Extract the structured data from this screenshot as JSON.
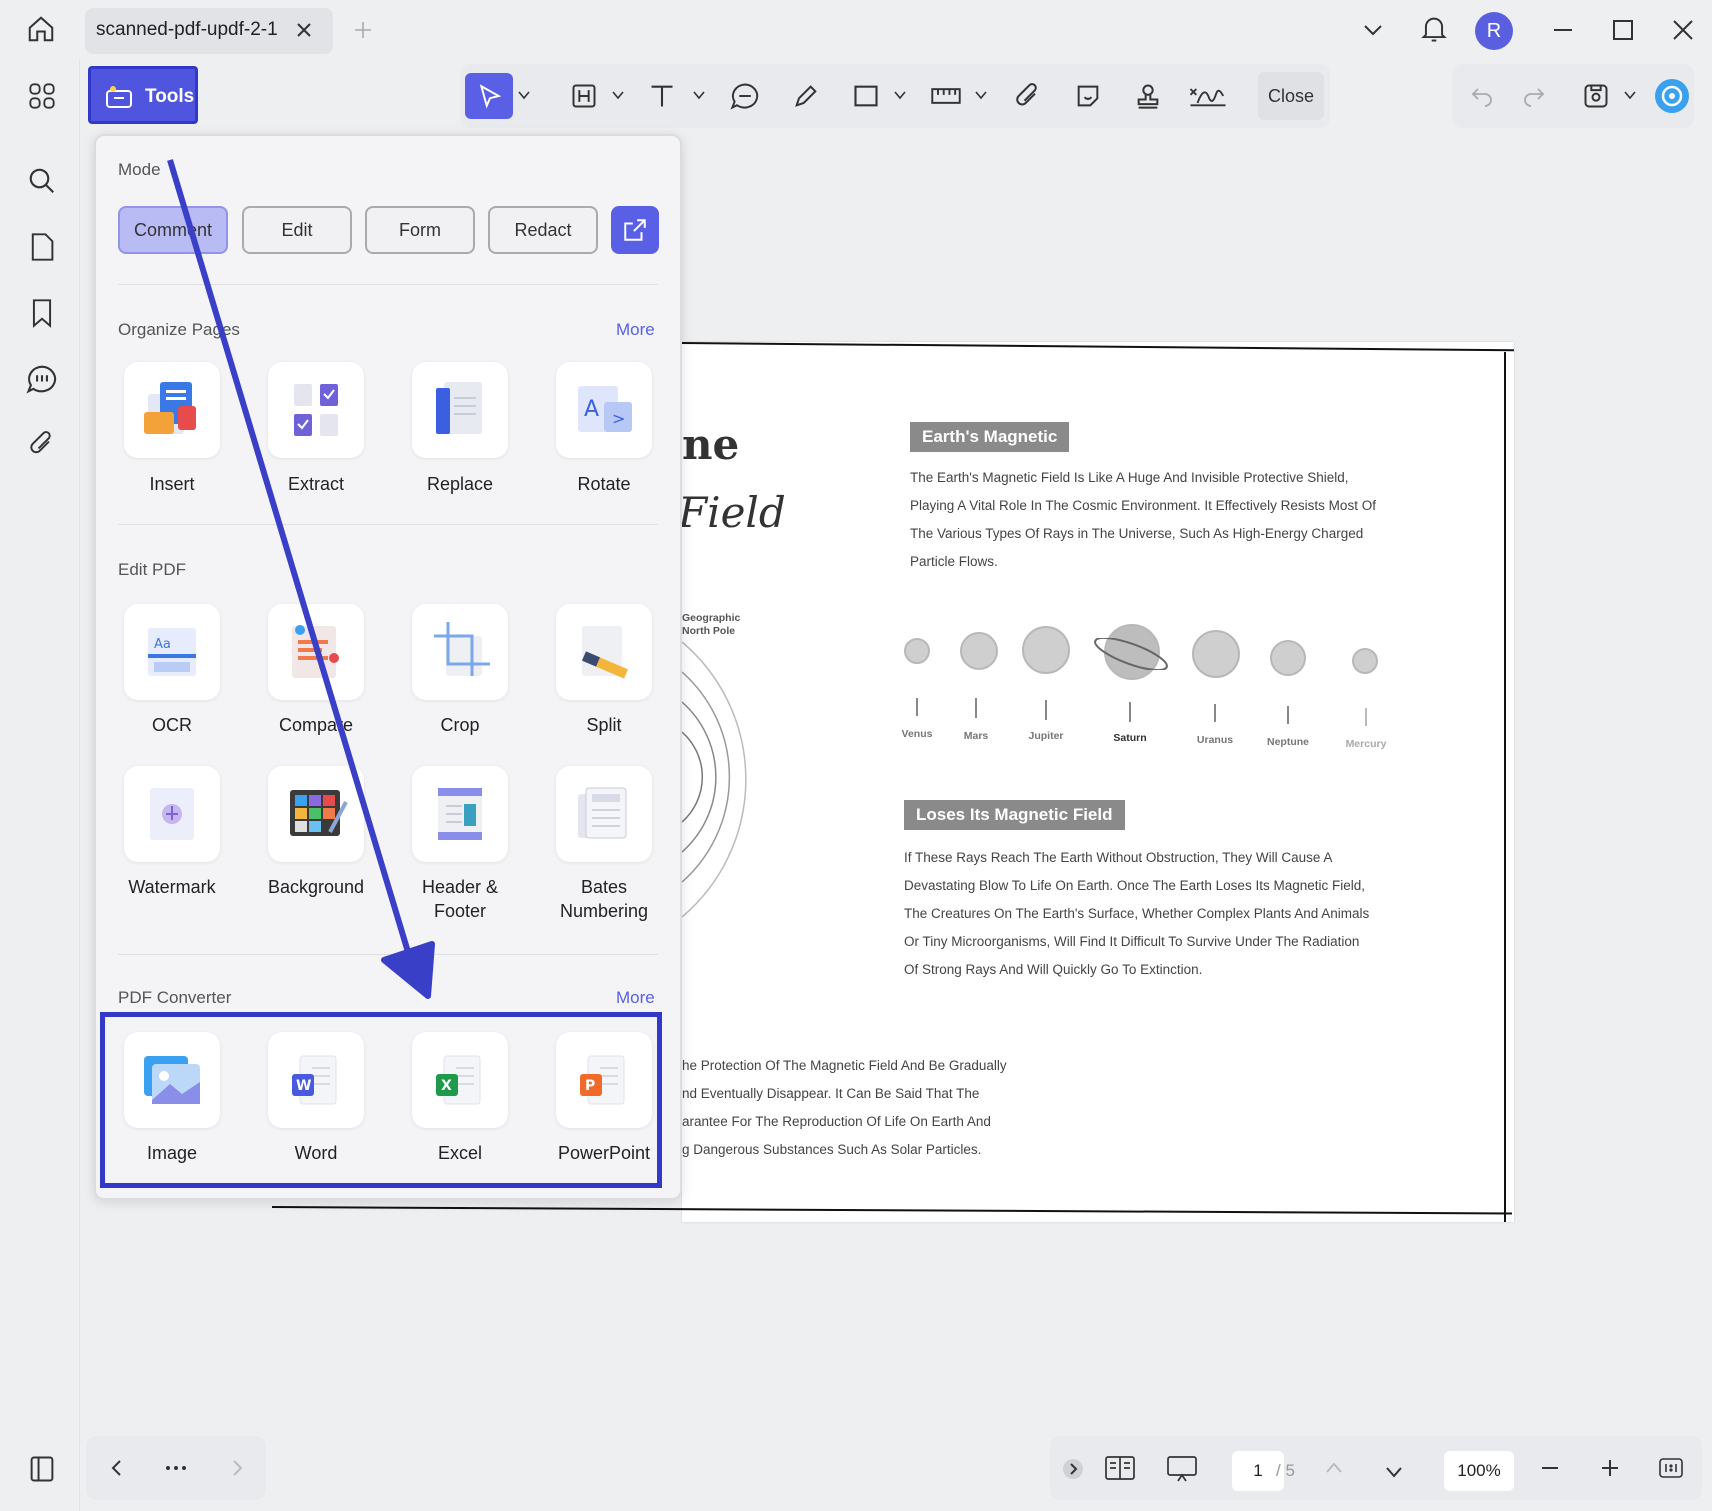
{
  "app": {
    "tab_title": "scanned-pdf-updf-2-1",
    "user_initial": "R"
  },
  "toolbar": {
    "tools_label": "Tools",
    "close_label": "Close"
  },
  "panel": {
    "mode_title": "Mode",
    "modes": [
      "Comment",
      "Edit",
      "Form",
      "Redact"
    ],
    "active_mode": "Comment",
    "organize": {
      "title": "Organize Pages",
      "more": "More",
      "items": [
        "Insert",
        "Extract",
        "Replace",
        "Rotate"
      ]
    },
    "edit": {
      "title": "Edit PDF",
      "items": [
        "OCR",
        "Compare",
        "Crop",
        "Split"
      ],
      "items2": [
        "Watermark",
        "Background",
        "Header &",
        "Footer",
        "Bates",
        "Numbering"
      ]
    },
    "converter": {
      "title": "PDF Converter",
      "more": "More",
      "items": [
        "Image",
        "Word",
        "Excel",
        "PowerPoint"
      ]
    }
  },
  "document": {
    "heading_frag1": "ne",
    "heading_frag2": "Field",
    "badge1": "Earth's Magnetic",
    "para1": "The Earth's Magnetic Field Is Like A Huge And Invisible Protective Shield, Playing A Vital Role In The Cosmic Environment. It Effectively Resists Most Of The Various Types Of Rays in The Universe, Such As High-Energy Charged Particle Flows.",
    "geo_label": "Geographic North Pole",
    "planets": [
      "Venus",
      "Mars",
      "Jupiter",
      "Saturn",
      "Uranus",
      "Neptune",
      "Mercury"
    ],
    "badge2": "Loses Its Magnetic Field",
    "para2": "If These Rays Reach The Earth Without Obstruction, They Will Cause A Devastating Blow To Life On Earth. Once The Earth Loses Its Magnetic Field, The Creatures On The Earth's Surface, Whether Complex Plants And Animals Or Tiny Microorganisms, Will Find It Difficult To Survive Under The Radiation Of Strong Rays And Will Quickly Go To Extinction.",
    "para3_lines": [
      "he Protection Of The Magnetic Field And Be Gradually",
      "nd Eventually Disappear. It Can Be Said That The",
      "arantee For The Reproduction Of Life On Earth And",
      "g Dangerous Substances Such As Solar Particles."
    ]
  },
  "bottom": {
    "current_page": "1",
    "total_pages": "/ 5",
    "zoom": "100%"
  },
  "colors": {
    "accent": "#5a60e6",
    "highlight": "#3238c8"
  }
}
